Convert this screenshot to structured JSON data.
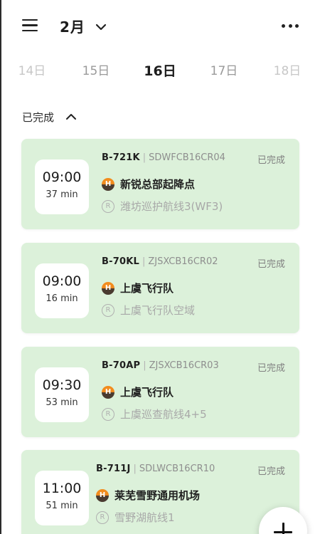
{
  "header": {
    "month": "2月"
  },
  "dates": [
    {
      "label": "14日"
    },
    {
      "label": "15日"
    },
    {
      "label": "16日"
    },
    {
      "label": "17日"
    },
    {
      "label": "18日"
    }
  ],
  "section": {
    "title": "已完成"
  },
  "flights": [
    {
      "time": "09:00",
      "duration": "37 min",
      "registration": "B-721K",
      "separator": "|",
      "code": "SDWFCB16CR04",
      "status": "已完成",
      "location": "新锐总部起降点",
      "route_symbol": "R",
      "route": "潍坊巡护航线3(WF3)"
    },
    {
      "time": "09:00",
      "duration": "16 min",
      "registration": "B-70KL",
      "separator": "|",
      "code": "ZJSXCB16CR02",
      "status": "已完成",
      "location": "上虞飞行队",
      "route_symbol": "R",
      "route": "上虞飞行队空域"
    },
    {
      "time": "09:30",
      "duration": "53 min",
      "registration": "B-70AP",
      "separator": "|",
      "code": "ZJSXCB16CR03",
      "status": "已完成",
      "location": "上虞飞行队",
      "route_symbol": "R",
      "route": "上虞巡查航线4+5"
    },
    {
      "time": "11:00",
      "duration": "51 min",
      "registration": "B-711J",
      "separator": "|",
      "code": "SDLWCB16CR10",
      "status": "已完成",
      "location": "莱芜雪野通用机场",
      "route_symbol": "R",
      "route": "雪野湖航线1"
    }
  ],
  "colors": {
    "card_background": "#dcf1da",
    "heliport_orange": "#f28c1e",
    "heliport_dark": "#4a3b30"
  }
}
